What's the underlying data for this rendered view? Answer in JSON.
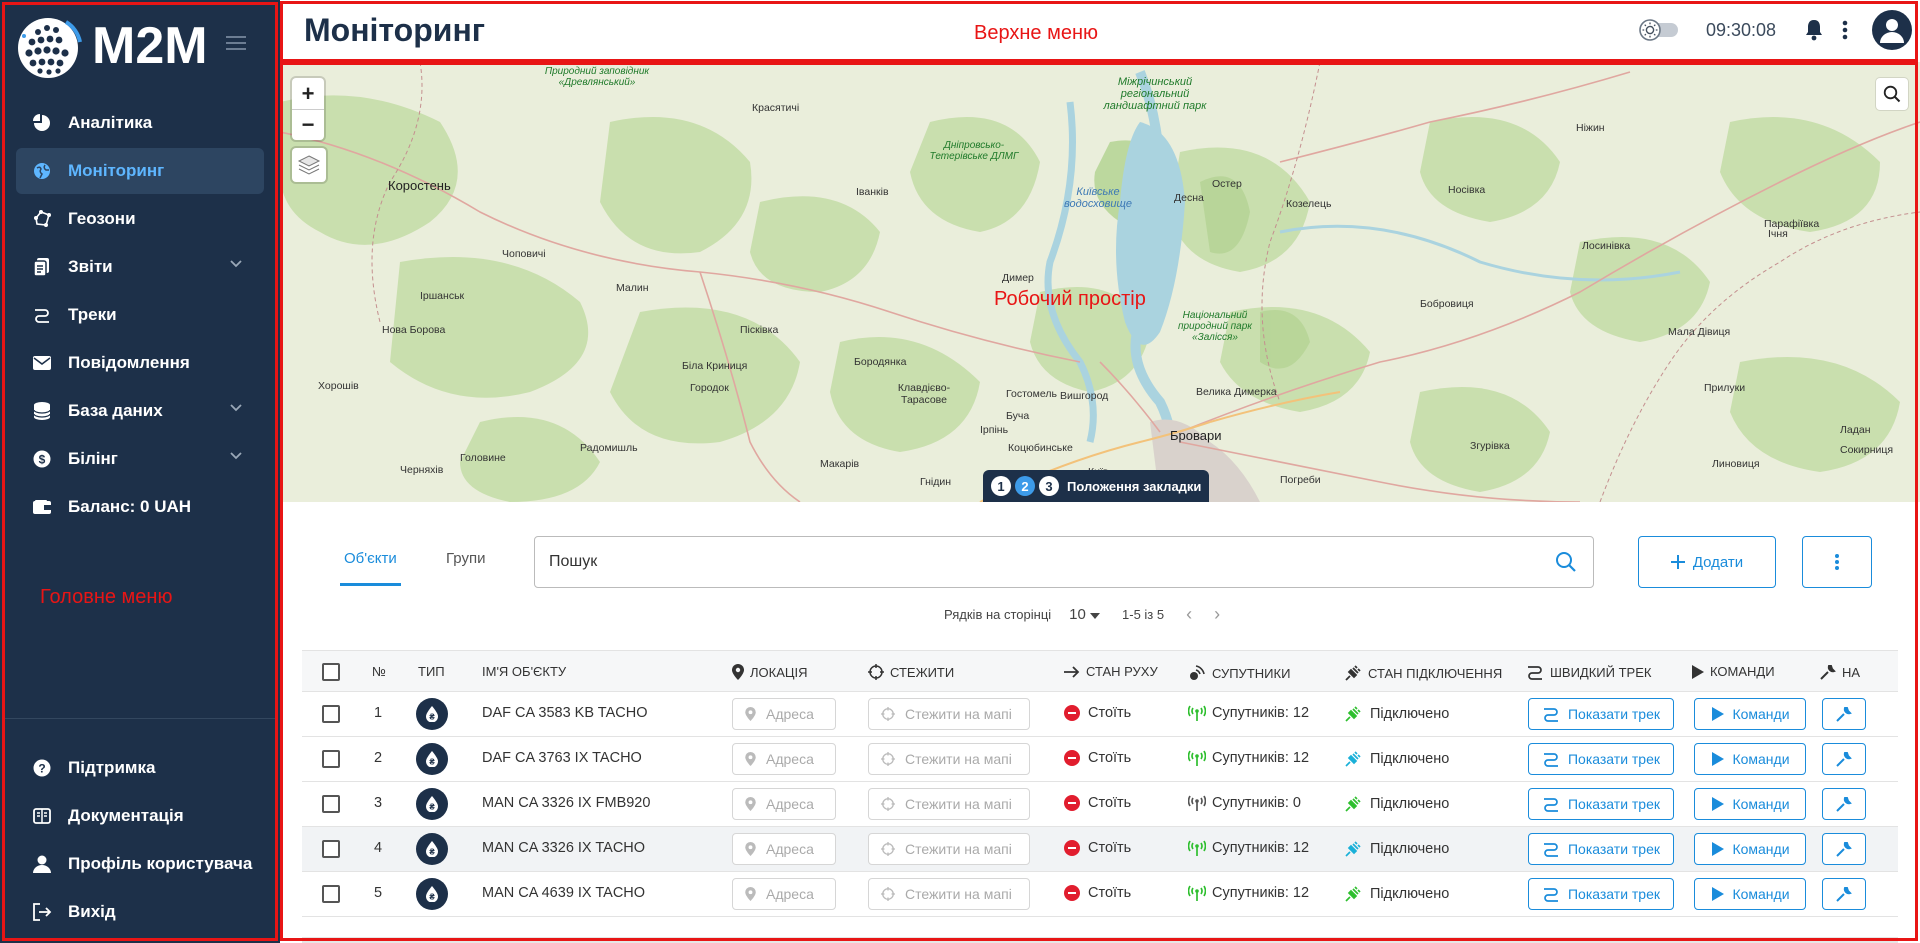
{
  "sidebar": {
    "logo": "M2M",
    "items": [
      {
        "label": "Аналітика",
        "icon": "analytics-icon"
      },
      {
        "label": "Моніторинг",
        "icon": "globe-icon",
        "active": true
      },
      {
        "label": "Геозони",
        "icon": "geozone-icon"
      },
      {
        "label": "Звіти",
        "icon": "report-icon",
        "expandable": true
      },
      {
        "label": "Треки",
        "icon": "route-icon"
      },
      {
        "label": "Повідомлення",
        "icon": "mail-icon"
      },
      {
        "label": "База даних",
        "icon": "database-icon",
        "expandable": true
      },
      {
        "label": "Білінг",
        "icon": "dollar-icon",
        "expandable": true
      },
      {
        "label": "Баланс: 0 UAH",
        "icon": "wallet-icon"
      }
    ],
    "annotation": "Головне меню",
    "bottom_items": [
      {
        "label": "Підтримка",
        "icon": "help-icon"
      },
      {
        "label": "Документація",
        "icon": "book-icon"
      },
      {
        "label": "Профіль користувача",
        "icon": "user-icon"
      },
      {
        "label": "Вихід",
        "icon": "logout-icon"
      }
    ]
  },
  "topbar": {
    "title": "Моніторинг",
    "annotation": "Верхне меню",
    "time": "09:30:08"
  },
  "map": {
    "annotation": "Робочий простір",
    "places": [
      {
        "name": "Коростень"
      },
      {
        "name": "Красятичі"
      },
      {
        "name": "Іванків"
      },
      {
        "name": "Чоповичі"
      },
      {
        "name": "Іршанськ"
      },
      {
        "name": "Малин"
      },
      {
        "name": "Нова Борова"
      },
      {
        "name": "Хорошів"
      },
      {
        "name": "Пісківка"
      },
      {
        "name": "Бородянка"
      },
      {
        "name": "Біла Криниця"
      },
      {
        "name": "Городок"
      },
      {
        "name": "Клавдієво-Тарасове"
      },
      {
        "name": "Гостомель"
      },
      {
        "name": "Вишгород"
      },
      {
        "name": "Буча"
      },
      {
        "name": "Ірпінь"
      },
      {
        "name": "Коцюбинське"
      },
      {
        "name": "Бровари"
      },
      {
        "name": "Велика Димерка"
      },
      {
        "name": "Радомишль"
      },
      {
        "name": "Черняхів"
      },
      {
        "name": "Головине"
      },
      {
        "name": "Макарів"
      },
      {
        "name": "Димер"
      },
      {
        "name": "Десна"
      },
      {
        "name": "Остер"
      },
      {
        "name": "Козелець"
      },
      {
        "name": "Носівка"
      },
      {
        "name": "Ніжин"
      },
      {
        "name": "Лосинівка"
      },
      {
        "name": "Бобровиця"
      },
      {
        "name": "Парафіївка"
      },
      {
        "name": "Ічня"
      },
      {
        "name": "Мала Дівиця"
      },
      {
        "name": "Прилуки"
      },
      {
        "name": "Згурівка"
      },
      {
        "name": "Линовиця"
      },
      {
        "name": "Ладан"
      },
      {
        "name": "Сокирниця"
      },
      {
        "name": "Погреби"
      },
      {
        "name": "Київ"
      },
      {
        "name": "Гнідин"
      }
    ],
    "parks": [
      "Природний заповідник «Древлянський»",
      "Дніпровсько-Тетерівське ДЛМГ",
      "Міжрічинський регіональний ландшафтний парк",
      "Національний природний парк «Залісся»"
    ],
    "water": "Київське водосховище",
    "bookmarks": {
      "numbers": [
        "1",
        "2",
        "3"
      ],
      "active_index": 1,
      "label": "Положення закладки"
    }
  },
  "panel": {
    "tabs": [
      "Об'єкти",
      "Групи"
    ],
    "search_placeholder": "Пошук",
    "add_label": "Додати",
    "pager": {
      "rows_label": "Рядків на сторінці",
      "rows_value": "10",
      "range": "1-5 із 5"
    },
    "columns": [
      "№",
      "ТИП",
      "ІМ'Я ОБ'ЄКТУ",
      "ЛОКАЦІЯ",
      "СТЕЖИТИ",
      "СТАН РУХУ",
      "СУПУТНИКИ",
      "СТАН ПІДКЛЮЧЕННЯ",
      "ШВИДКИЙ ТРЕК",
      "КОМАНДИ",
      "НА"
    ],
    "address_placeholder": "Адреса",
    "follow_label": "Стежити на мапі",
    "track_label": "Показати трек",
    "commands_label": "Команди",
    "rows": [
      {
        "num": "1",
        "name": "DAF CA 3583 KB TACHO",
        "motion": "Стоїть",
        "sats": "Супутників: 12",
        "conn": "Підключено",
        "sats_ok": true
      },
      {
        "num": "2",
        "name": "DAF CA 3763 IX TACHO",
        "motion": "Стоїть",
        "sats": "Супутників: 12",
        "conn": "Підключено",
        "sats_ok": true
      },
      {
        "num": "3",
        "name": "MAN CA 3326 IX FMB920",
        "motion": "Стоїть",
        "sats": "Супутників: 0",
        "conn": "Підключено",
        "sats_ok": false
      },
      {
        "num": "4",
        "name": "MAN CA 3326 IX TACHO",
        "motion": "Стоїть",
        "sats": "Супутників: 12",
        "conn": "Підключено",
        "sats_ok": true
      },
      {
        "num": "5",
        "name": "MAN CA 4639 IX TACHO",
        "motion": "Стоїть",
        "sats": "Супутників: 12",
        "conn": "Підключено",
        "sats_ok": true
      }
    ]
  },
  "colors": {
    "sidebar_bg": "#1d3049",
    "accent": "#1a8cdb",
    "annotation": "#e81515",
    "stop": "#e11d2e",
    "ok_green": "#2fbf2f"
  }
}
